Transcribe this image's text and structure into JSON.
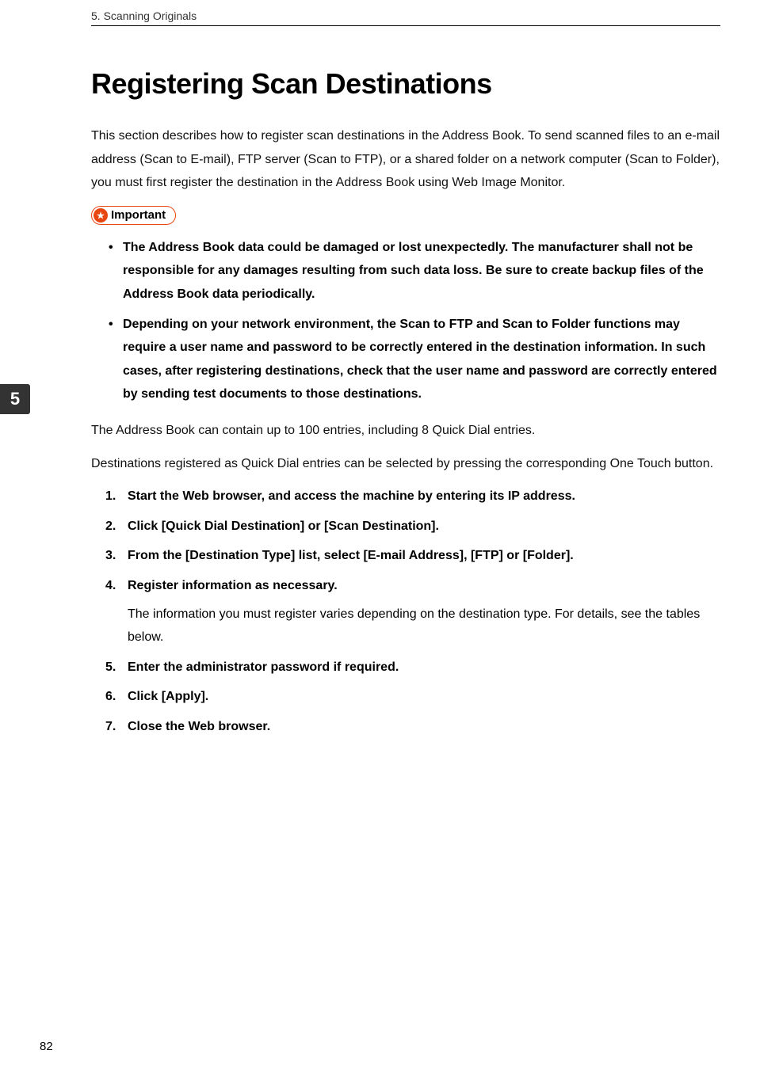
{
  "header": {
    "chapter": "5. Scanning Originals"
  },
  "sideTab": {
    "number": "5"
  },
  "title": "Registering Scan Destinations",
  "intro": "This section describes how to register scan destinations in the Address Book. To send scanned files to an e-mail address (Scan to E-mail), FTP server (Scan to FTP), or a shared folder on a network computer (Scan to Folder), you must first register the destination in the Address Book using Web Image Monitor.",
  "important": {
    "label": "Important",
    "bullets": [
      "The Address Book data could be damaged or lost unexpectedly. The manufacturer shall not be responsible for any damages resulting from such data loss. Be sure to create backup files of the Address Book data periodically.",
      "Depending on your network environment, the Scan to FTP and Scan to Folder functions may require a user name and password to be correctly entered in the destination information. In such cases, after registering destinations, check that the user name and password are correctly entered by sending test documents to those destinations."
    ]
  },
  "body": [
    "The Address Book can contain up to 100 entries, including 8 Quick Dial entries.",
    "Destinations registered as Quick Dial entries can be selected by pressing the corresponding One Touch button."
  ],
  "steps": [
    {
      "title": "Start the Web browser, and access the machine by entering its IP address."
    },
    {
      "title": "Click [Quick Dial Destination] or [Scan Destination]."
    },
    {
      "title": "From the [Destination Type] list, select [E-mail Address], [FTP] or [Folder]."
    },
    {
      "title": "Register information as necessary.",
      "note": "The information you must register varies depending on the destination type. For details, see the tables below."
    },
    {
      "title": "Enter the administrator password if required."
    },
    {
      "title": "Click [Apply]."
    },
    {
      "title": "Close the Web browser."
    }
  ],
  "pageNumber": "82"
}
